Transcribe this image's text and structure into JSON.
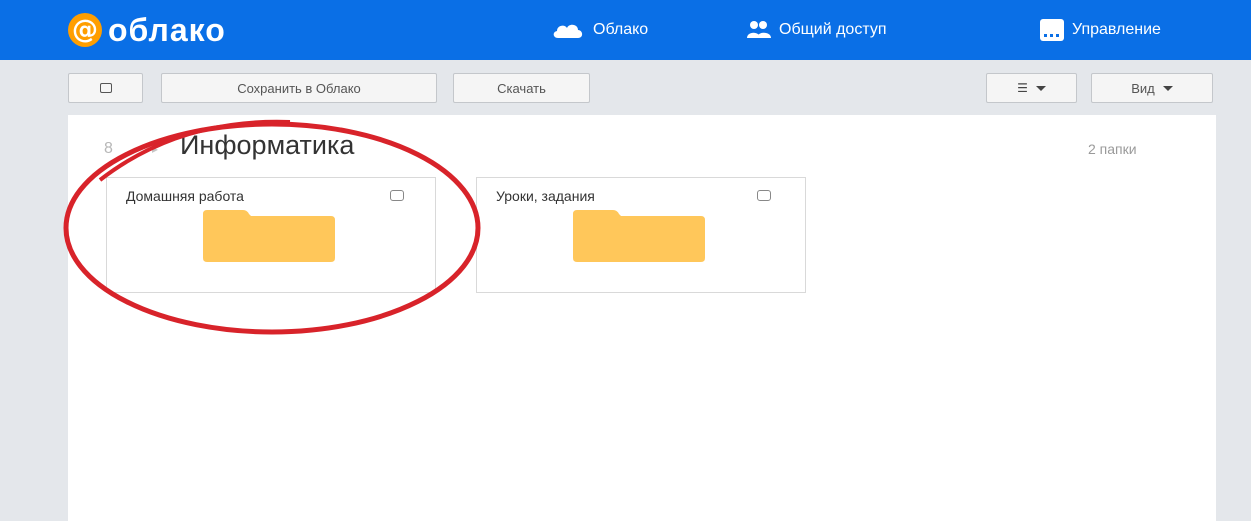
{
  "brand": {
    "at": "@",
    "name": "облако"
  },
  "nav": [
    {
      "label": "Облако",
      "icon": "cloud-icon"
    },
    {
      "label": "Общий доступ",
      "icon": "people-icon"
    },
    {
      "label": "Управление",
      "icon": "manage-icon"
    }
  ],
  "toolbar": {
    "save_label": "Сохранить в Облако",
    "download_label": "Скачать",
    "view_label": "Вид"
  },
  "breadcrumb": {
    "prev": "8",
    "sep": "▸"
  },
  "folder_title": "Информатика",
  "folder_count": "2 папки",
  "folders": [
    {
      "name": "Домашняя работа",
      "icon": "folder-icon"
    },
    {
      "name": "Уроки, задания",
      "icon": "folder-icon"
    }
  ],
  "colors": {
    "topbar": "#0a6fe6",
    "logo_badge": "#ff9e00",
    "folder": "#ffc75a",
    "annotation_circle": "#d8232a"
  }
}
